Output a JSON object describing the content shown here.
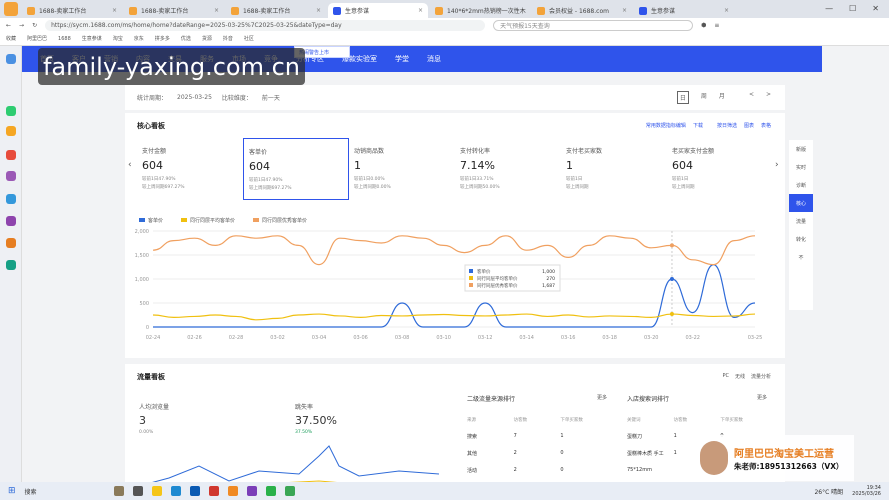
{
  "browser": {
    "tabs": [
      {
        "label": "1688-卖家工作台",
        "active": false,
        "color": "#f3a33a"
      },
      {
        "label": "1688-卖家工作台",
        "active": false,
        "color": "#f3a33a"
      },
      {
        "label": "1688-卖家工作台",
        "active": false,
        "color": "#f3a33a"
      },
      {
        "label": "生意参谋",
        "active": true,
        "color": "#2f54eb"
      },
      {
        "label": "140*6*2mm热销榜一次性木",
        "active": false,
        "color": "#f3a33a"
      },
      {
        "label": "会员权益 - 1688.com",
        "active": false,
        "color": "#f3a33a"
      },
      {
        "label": "生意参谋",
        "active": false,
        "color": "#2f54eb"
      }
    ],
    "url": "https://sycm.1688.com/ms/home/home?dateRange=2025-03-25%7C2025-03-25&dateType=day",
    "search_placeholder": "天气预报15天查询",
    "bookmarks": [
      "收藏",
      "阿里巴巴",
      "1688",
      "生意参谋",
      "淘宝",
      "京东",
      "拼多多",
      "优选",
      "货源",
      "抖音",
      "社区"
    ]
  },
  "watermark": "family-yaxing.com.cn",
  "nav": {
    "items": [
      "首页",
      "客户",
      "营销",
      "内容",
      "交易",
      "服务",
      "市场",
      "竞争",
      "分析专区",
      "爆款实验室",
      "学堂",
      "消息"
    ],
    "popup": "热闹警告上市"
  },
  "date_bar": {
    "period_label": "统计周期：",
    "period_value": "2025-03-25",
    "compare_label": "比较维度：",
    "compare_value": "前一天",
    "controls": [
      "日",
      "周",
      "月",
      "",
      "<",
      ">"
    ]
  },
  "core": {
    "title": "核心看板",
    "options": [
      "常用数据指标编辑",
      "下载",
      "",
      "按日筛选",
      "图表",
      "表格"
    ],
    "metrics": [
      {
        "name": "支付金额",
        "value": "604",
        "l1": "较前1日47.90%",
        "l2": "较上周同期697.27%"
      },
      {
        "name": "客单价",
        "value": "604",
        "l1": "较前1日47.90%",
        "l2": "较上周同期697.27%"
      },
      {
        "name": "动销商品数",
        "value": "1",
        "l1": "较前1日0.00%",
        "l2": "较上周同期0.00%"
      },
      {
        "name": "支付转化率",
        "value": "7.14%",
        "l1": "较前1日33.71%",
        "l2": "较上周同期50.00%"
      },
      {
        "name": "支付老买家数",
        "value": "1",
        "l1": "较前1日",
        "l2": "较上周同期"
      },
      {
        "name": "老买家支付金额",
        "value": "604",
        "l1": "较前1日",
        "l2": "较上周同期"
      }
    ],
    "legend": [
      {
        "name": "客单价",
        "color": "#2f6bd8"
      },
      {
        "name": "同行同层平均客单价",
        "color": "#f0c010"
      },
      {
        "name": "同行同层优秀客单价",
        "color": "#f0a060"
      }
    ]
  },
  "chart_data": {
    "type": "line",
    "x": [
      "02-24",
      "02-25",
      "02-26",
      "02-27",
      "02-28",
      "03-01",
      "03-02",
      "03-03",
      "03-04",
      "03-05",
      "03-06",
      "03-07",
      "03-08",
      "03-09",
      "03-10",
      "03-11",
      "03-12",
      "03-13",
      "03-14",
      "03-15",
      "03-16",
      "03-17",
      "03-18",
      "03-19",
      "03-20",
      "03-21",
      "03-22",
      "03-23",
      "03-24",
      "03-25"
    ],
    "series": [
      {
        "name": "客单价",
        "color": "#2f6bd8",
        "values": [
          0,
          0,
          0,
          0,
          0,
          0,
          0,
          0,
          0,
          0,
          0,
          0,
          500,
          0,
          0,
          0,
          500,
          0,
          0,
          0,
          0,
          0,
          0,
          0,
          0,
          1000,
          300,
          1300,
          200,
          500
        ]
      },
      {
        "name": "同行同层平均客单价",
        "color": "#f0c010",
        "values": [
          250,
          200,
          220,
          250,
          220,
          150,
          180,
          250,
          270,
          230,
          200,
          240,
          230,
          250,
          260,
          240,
          230,
          250,
          270,
          220,
          250,
          210,
          230,
          220,
          200,
          270,
          240,
          220,
          230,
          270
        ]
      },
      {
        "name": "同行同层优秀客单价",
        "color": "#f0a060",
        "values": [
          1600,
          1800,
          1850,
          1700,
          1900,
          1850,
          1900,
          1700,
          1300,
          1850,
          1800,
          1750,
          1900,
          1850,
          1700,
          1550,
          1700,
          1900,
          1600,
          1700,
          1450,
          1700,
          1900,
          1850,
          1650,
          1700,
          1400,
          1300,
          1800,
          1900
        ]
      }
    ],
    "ylim": [
      0,
      2000
    ],
    "yticks": [
      "0",
      "500",
      "1,000",
      "1,500",
      "2,000"
    ],
    "xticks": [
      "02-24",
      "02-26",
      "02-28",
      "03-02",
      "03-04",
      "03-06",
      "03-08",
      "03-10",
      "03-12",
      "03-14",
      "03-16",
      "03-18",
      "03-20",
      "03-22",
      "03-25"
    ],
    "tooltip": [
      {
        "name": "客单价",
        "value": "1,000"
      },
      {
        "name": "同行同层平均客单价",
        "value": "270"
      },
      {
        "name": "同行同层优秀客单价",
        "value": "1,687"
      }
    ]
  },
  "right_panel": [
    "新版",
    "实时",
    "诊断",
    "核心",
    "流量",
    "转化",
    "不"
  ],
  "flow": {
    "title": "流量看板",
    "opts": [
      "PC",
      "无线",
      "流量分析"
    ],
    "m1": {
      "name": "人均浏览量",
      "value": "3",
      "sub": "0.00%"
    },
    "m2": {
      "name": "跳失率",
      "value": "37.50%",
      "sub": "37.50%"
    },
    "t1": {
      "title": "二级流量来源排行",
      "more": "更多",
      "cols": [
        "来源",
        "访客数",
        "下单买家数"
      ],
      "rows": [
        [
          "搜索",
          "7",
          "1"
        ],
        [
          "其他",
          "2",
          "0"
        ],
        [
          "活动",
          "2",
          "0"
        ]
      ]
    },
    "t2": {
      "title": "入店搜索词排行",
      "more": "更多",
      "cols": [
        "关键词",
        "访客数",
        "下单买家数"
      ],
      "rows": [
        [
          "蛋糕刀",
          "1",
          "0"
        ],
        [
          "蛋糕棒木质 手工",
          "1",
          "0"
        ],
        [
          "75*12mm",
          "",
          ""
        ]
      ]
    }
  },
  "promo": {
    "brand": "阿里巴巴淘宝美工运营",
    "teacher": "朱老师:18951312663（VX）"
  },
  "taskbar": {
    "search": "搜索",
    "weather": "26°C 晴朗",
    "time": "19:34",
    "date": "2025/03/26"
  }
}
